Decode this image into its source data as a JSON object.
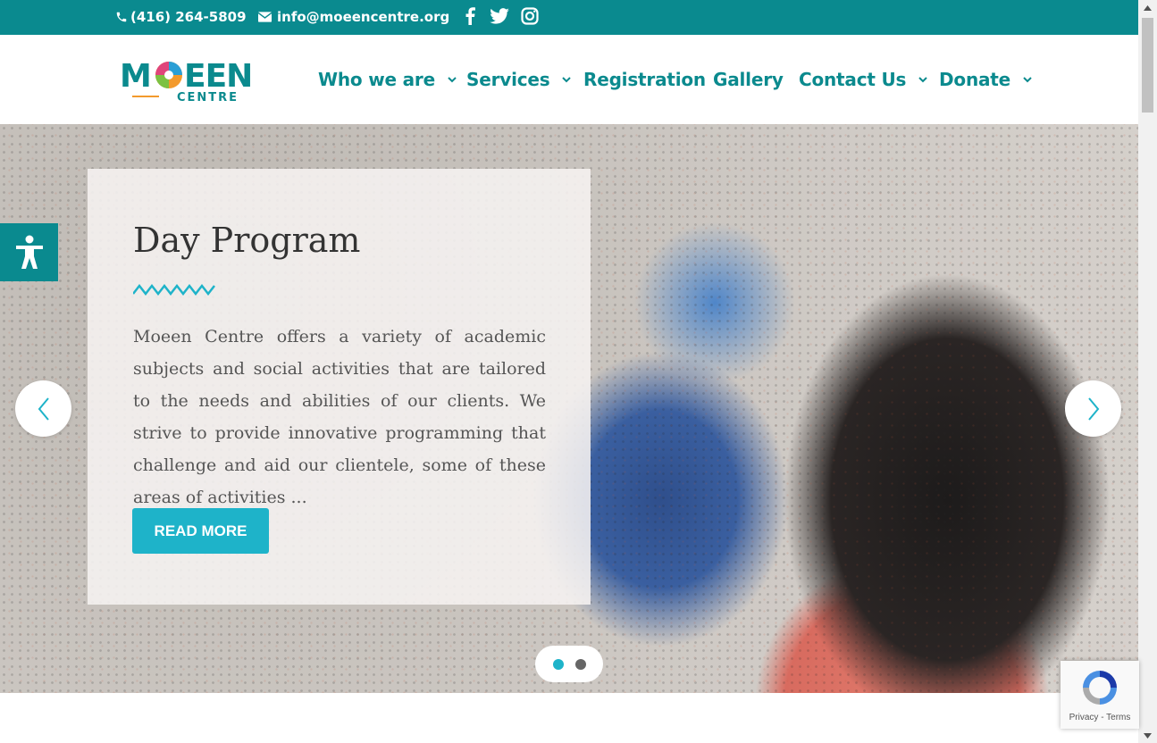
{
  "topbar": {
    "phone": "(416) 264-5809",
    "email": "info@moeencentre.org",
    "social_icons": [
      "facebook-icon",
      "twitter-icon",
      "instagram-icon"
    ]
  },
  "logo": {
    "word_top": "MOEEN",
    "word_bottom": "CENTRE"
  },
  "nav": {
    "items": [
      {
        "label": "Who we are",
        "has_dropdown": true
      },
      {
        "label": "Services",
        "has_dropdown": true
      },
      {
        "label": "Registration",
        "has_dropdown": false
      },
      {
        "label": "Gallery",
        "has_dropdown": false
      },
      {
        "label": "Contact Us",
        "has_dropdown": true
      },
      {
        "label": "Donate",
        "has_dropdown": true
      }
    ]
  },
  "hero": {
    "title": "Day Program",
    "text": "Moeen Centre offers a variety of academic subjects and social activities that are tailored to the needs and abilities of our clients. We strive to provide innovative programming that challenge and aid our clientele, some of these areas of activities ...",
    "button": "READ MORE",
    "slides_total": 2,
    "active_slide": 1
  },
  "recaptcha": {
    "privacy": "Privacy",
    "separator": " - ",
    "terms": "Terms"
  },
  "colors": {
    "brand_teal": "#0a8a8f",
    "button_cyan": "#1eb3c9",
    "accent_orange": "#f39a2c"
  }
}
